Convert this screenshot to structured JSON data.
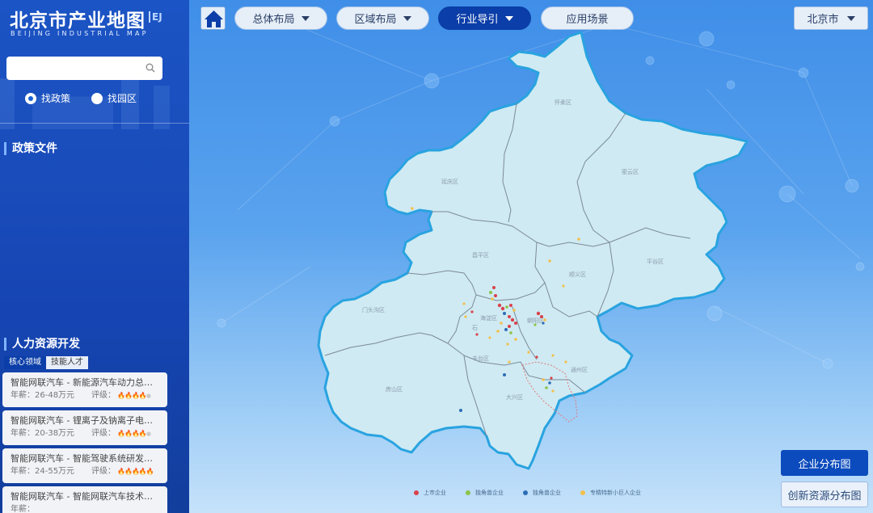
{
  "brand": {
    "title": "北京市产业地图",
    "mark": "EJ",
    "subtitle": "BEIJING INDUSTRIAL MAP"
  },
  "search": {
    "value": "",
    "placeholder": "",
    "icon": "search-icon"
  },
  "search_mode": {
    "options": [
      {
        "label": "找政策",
        "selected": true
      },
      {
        "label": "找园区",
        "selected": false
      }
    ]
  },
  "sections": {
    "policy_title": "政策文件",
    "hr_title": "人力资源开发"
  },
  "hr_tabs": [
    {
      "label": "核心领域",
      "active": true
    },
    {
      "label": "技能人才",
      "active": false
    }
  ],
  "jobs": [
    {
      "title": "智能网联汽车 - 新能源汽车动力总成…",
      "salary_label": "年薪：",
      "salary": "26-48万元",
      "rating_label": "评级：",
      "rating": 4,
      "rating_max": 5
    },
    {
      "title": "智能网联汽车 - 锂离子及钠离子电池…",
      "salary_label": "年薪：",
      "salary": "20-38万元",
      "rating_label": "评级：",
      "rating": 4,
      "rating_max": 5
    },
    {
      "title": "智能网联汽车 - 智能驾驶系统研发与…",
      "salary_label": "年薪：",
      "salary": "24-55万元",
      "rating_label": "评级：",
      "rating": 5,
      "rating_max": 5
    },
    {
      "title": "智能网联汽车 - 智能网联汽车技术研…",
      "salary_label": "年薪：",
      "salary": "",
      "rating_label": "",
      "rating": 0,
      "rating_max": 5
    }
  ],
  "topnav": {
    "home_icon": "home-icon",
    "items": [
      {
        "label": "总体布局",
        "has_dropdown": true,
        "active": false
      },
      {
        "label": "区域布局",
        "has_dropdown": true,
        "active": false
      },
      {
        "label": "行业导引",
        "has_dropdown": true,
        "active": true
      },
      {
        "label": "应用场景",
        "has_dropdown": false,
        "active": false
      }
    ],
    "city": "北京市"
  },
  "map": {
    "districts": [
      "怀柔区",
      "延庆区",
      "密云区",
      "昌平区",
      "顺义区",
      "平谷区",
      "门头沟区",
      "海淀区",
      "朝阳区",
      "丰台区",
      "石",
      "通州区",
      "房山区",
      "大兴区"
    ],
    "fill_color": "#cfeaf2",
    "border_color": "#29a3e0"
  },
  "legend": [
    {
      "label": "上市企业",
      "color": "#d9434b"
    },
    {
      "label": "独角兽企业",
      "color": "#8bc34a"
    },
    {
      "label": "独角兽企业",
      "color": "#2c6db5"
    },
    {
      "label": "专精特新小巨人企业",
      "color": "#f2c14e"
    }
  ],
  "side_buttons": {
    "enterprise": "企业分布图",
    "innovation": "创新资源分布图"
  }
}
